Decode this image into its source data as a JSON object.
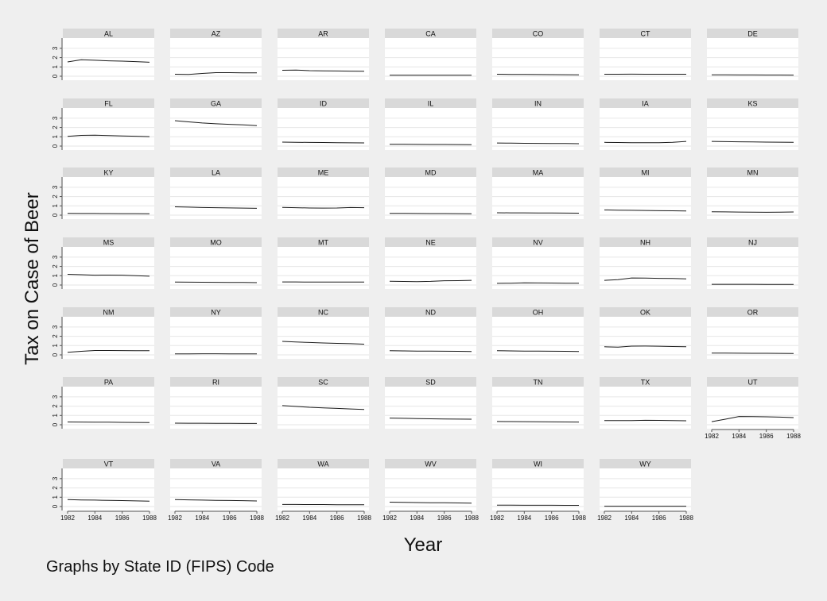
{
  "chart_data": {
    "type": "line",
    "ylabel": "Tax on Case of Beer",
    "xlabel": "Year",
    "note": "Graphs by State ID (FIPS) Code",
    "x": [
      1982,
      1983,
      1984,
      1985,
      1986,
      1987,
      1988
    ],
    "xticks": [
      "1982",
      "1984",
      "1986",
      "1988"
    ],
    "yticks": [
      "0",
      "1",
      "2",
      "3"
    ],
    "ylim": [
      0,
      3.5
    ],
    "xlim": [
      1982,
      1988
    ],
    "panels": [
      {
        "name": "AL",
        "values": [
          1.54,
          1.77,
          1.72,
          1.66,
          1.62,
          1.57,
          1.5
        ]
      },
      {
        "name": "AZ",
        "values": [
          0.21,
          0.2,
          0.3,
          0.38,
          0.38,
          0.37,
          0.36
        ]
      },
      {
        "name": "AR",
        "values": [
          0.64,
          0.67,
          0.6,
          0.57,
          0.56,
          0.55,
          0.53
        ]
      },
      {
        "name": "CA",
        "values": [
          0.1,
          0.1,
          0.1,
          0.1,
          0.1,
          0.1,
          0.1
        ]
      },
      {
        "name": "CO",
        "values": [
          0.21,
          0.2,
          0.19,
          0.18,
          0.17,
          0.16,
          0.15
        ]
      },
      {
        "name": "CT",
        "values": [
          0.21,
          0.21,
          0.22,
          0.21,
          0.21,
          0.21,
          0.21
        ]
      },
      {
        "name": "DE",
        "values": [
          0.15,
          0.15,
          0.14,
          0.14,
          0.13,
          0.13,
          0.12
        ]
      },
      {
        "name": "FL",
        "values": [
          1.05,
          1.15,
          1.18,
          1.13,
          1.09,
          1.06,
          1.02
        ]
      },
      {
        "name": "GA",
        "values": [
          2.73,
          2.6,
          2.48,
          2.4,
          2.34,
          2.28,
          2.2
        ]
      },
      {
        "name": "ID",
        "values": [
          0.43,
          0.41,
          0.39,
          0.38,
          0.36,
          0.35,
          0.34
        ]
      },
      {
        "name": "IL",
        "values": [
          0.2,
          0.19,
          0.18,
          0.17,
          0.17,
          0.16,
          0.15
        ]
      },
      {
        "name": "IN",
        "values": [
          0.33,
          0.32,
          0.3,
          0.29,
          0.28,
          0.27,
          0.26
        ]
      },
      {
        "name": "IA",
        "values": [
          0.4,
          0.38,
          0.36,
          0.36,
          0.36,
          0.41,
          0.5
        ]
      },
      {
        "name": "KS",
        "values": [
          0.5,
          0.48,
          0.46,
          0.44,
          0.43,
          0.42,
          0.4
        ]
      },
      {
        "name": "KY",
        "values": [
          0.19,
          0.18,
          0.18,
          0.17,
          0.16,
          0.16,
          0.15
        ]
      },
      {
        "name": "LA",
        "values": [
          0.9,
          0.86,
          0.82,
          0.8,
          0.78,
          0.76,
          0.73
        ]
      },
      {
        "name": "ME",
        "values": [
          0.83,
          0.8,
          0.77,
          0.76,
          0.77,
          0.82,
          0.8
        ]
      },
      {
        "name": "MD",
        "values": [
          0.2,
          0.19,
          0.18,
          0.17,
          0.17,
          0.16,
          0.15
        ]
      },
      {
        "name": "MA",
        "values": [
          0.26,
          0.25,
          0.25,
          0.24,
          0.23,
          0.22,
          0.21
        ]
      },
      {
        "name": "MI",
        "values": [
          0.56,
          0.54,
          0.52,
          0.5,
          0.48,
          0.47,
          0.45
        ]
      },
      {
        "name": "MN",
        "values": [
          0.36,
          0.35,
          0.33,
          0.32,
          0.31,
          0.32,
          0.34
        ]
      },
      {
        "name": "MS",
        "values": [
          1.15,
          1.11,
          1.06,
          1.07,
          1.06,
          1.0,
          0.95
        ]
      },
      {
        "name": "MO",
        "values": [
          0.32,
          0.31,
          0.3,
          0.29,
          0.28,
          0.27,
          0.26
        ]
      },
      {
        "name": "MT",
        "values": [
          0.33,
          0.33,
          0.32,
          0.32,
          0.32,
          0.32,
          0.32
        ]
      },
      {
        "name": "NE",
        "values": [
          0.4,
          0.38,
          0.37,
          0.39,
          0.46,
          0.47,
          0.5
        ]
      },
      {
        "name": "NV",
        "values": [
          0.18,
          0.2,
          0.23,
          0.22,
          0.21,
          0.2,
          0.19
        ]
      },
      {
        "name": "NH",
        "values": [
          0.5,
          0.57,
          0.76,
          0.74,
          0.72,
          0.7,
          0.66
        ]
      },
      {
        "name": "NJ",
        "values": [
          0.08,
          0.08,
          0.08,
          0.08,
          0.07,
          0.07,
          0.07
        ]
      },
      {
        "name": "NM",
        "values": [
          0.27,
          0.38,
          0.47,
          0.47,
          0.46,
          0.45,
          0.44
        ]
      },
      {
        "name": "NY",
        "values": [
          0.1,
          0.11,
          0.12,
          0.12,
          0.11,
          0.11,
          0.1
        ]
      },
      {
        "name": "NC",
        "values": [
          1.45,
          1.38,
          1.33,
          1.28,
          1.24,
          1.2,
          1.15
        ]
      },
      {
        "name": "ND",
        "values": [
          0.45,
          0.43,
          0.41,
          0.4,
          0.39,
          0.38,
          0.37
        ]
      },
      {
        "name": "OH",
        "values": [
          0.45,
          0.43,
          0.41,
          0.4,
          0.39,
          0.38,
          0.37
        ]
      },
      {
        "name": "OK",
        "values": [
          0.87,
          0.84,
          0.94,
          0.95,
          0.93,
          0.9,
          0.87
        ]
      },
      {
        "name": "OR",
        "values": [
          0.2,
          0.19,
          0.18,
          0.17,
          0.17,
          0.16,
          0.15
        ]
      },
      {
        "name": "PA",
        "values": [
          0.3,
          0.29,
          0.28,
          0.27,
          0.26,
          0.25,
          0.24
        ]
      },
      {
        "name": "RI",
        "values": [
          0.17,
          0.16,
          0.16,
          0.15,
          0.15,
          0.14,
          0.14
        ]
      },
      {
        "name": "SC",
        "values": [
          2.06,
          1.97,
          1.88,
          1.82,
          1.76,
          1.7,
          1.65
        ]
      },
      {
        "name": "SD",
        "values": [
          0.72,
          0.69,
          0.66,
          0.64,
          0.62,
          0.61,
          0.6
        ]
      },
      {
        "name": "TN",
        "values": [
          0.35,
          0.34,
          0.33,
          0.32,
          0.31,
          0.3,
          0.29
        ]
      },
      {
        "name": "TX",
        "values": [
          0.45,
          0.44,
          0.44,
          0.48,
          0.47,
          0.45,
          0.43
        ]
      },
      {
        "name": "UT",
        "values": [
          0.33,
          0.6,
          0.89,
          0.87,
          0.85,
          0.82,
          0.77
        ]
      },
      {
        "name": "VT",
        "values": [
          0.74,
          0.71,
          0.69,
          0.66,
          0.64,
          0.61,
          0.58
        ]
      },
      {
        "name": "VA",
        "values": [
          0.75,
          0.72,
          0.69,
          0.67,
          0.65,
          0.63,
          0.6
        ]
      },
      {
        "name": "WA",
        "values": [
          0.22,
          0.22,
          0.21,
          0.21,
          0.2,
          0.2,
          0.19
        ]
      },
      {
        "name": "WV",
        "values": [
          0.47,
          0.45,
          0.43,
          0.41,
          0.4,
          0.38,
          0.37
        ]
      },
      {
        "name": "WI",
        "values": [
          0.15,
          0.15,
          0.14,
          0.14,
          0.14,
          0.13,
          0.13
        ]
      },
      {
        "name": "WY",
        "values": [
          0.03,
          0.03,
          0.03,
          0.03,
          0.03,
          0.03,
          0.03
        ]
      }
    ],
    "colors": {
      "background": "#efefef",
      "plot": "#ffffff",
      "strip": "#d9d9d9",
      "grid": "#e6e6e6",
      "line": "#1a1a1a",
      "text": "#111111"
    },
    "grid": true
  }
}
